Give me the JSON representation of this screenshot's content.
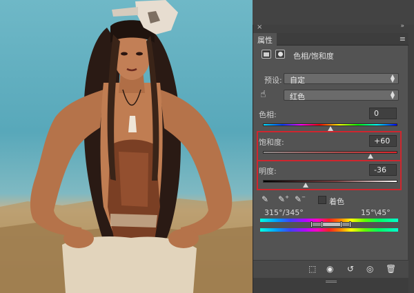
{
  "panel": {
    "tab_title": "属性",
    "adjustment_title": "色相/饱和度",
    "preset_label": "预设:",
    "preset_value": "自定",
    "channel_value": "红色",
    "hue_label": "色相:",
    "hue_value": "0",
    "saturation_label": "饱和度:",
    "saturation_value": "+60",
    "lightness_label": "明度:",
    "lightness_value": "-36",
    "colorize_label": "着色",
    "range_left": "315°/345°",
    "range_right": "15°\\45°",
    "hue_level": 0.5,
    "saturation_level": 0.8,
    "lightness_level": 0.32
  },
  "icons": {
    "close": "close-icon",
    "panel_menu": "panel-menu-icon",
    "adjustment": "adjustment-layer-icon",
    "mask": "mask-icon",
    "hand": "targeted-adjust-hand-icon",
    "eyedropper": "eyedropper-icon",
    "eyedropper_add": "eyedropper-add-icon",
    "eyedropper_subtract": "eyedropper-subtract-icon",
    "clip": "clip-to-layer-icon",
    "view_previous": "view-previous-state-icon",
    "reset": "reset-icon",
    "visibility": "visibility-eye-icon",
    "trash": "trash-icon"
  },
  "colors": {
    "panel_bg": "#535353",
    "highlight": "#d0262e"
  }
}
